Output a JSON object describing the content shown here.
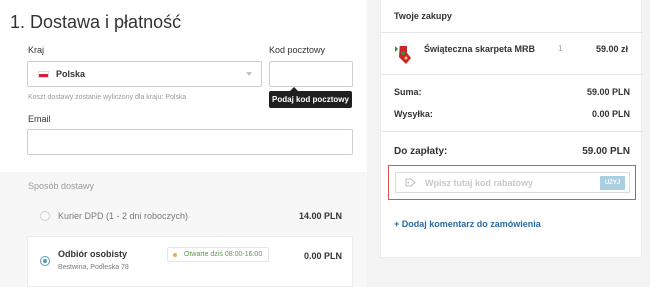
{
  "delivery": {
    "section_title": "1. Dostawa i płatność",
    "country_label": "Kraj",
    "country_value": "Polska",
    "postal_label": "Kod pocztowy",
    "postal_value": "",
    "postal_tooltip": "Podaj kod pocztowy",
    "shipping_hint": "Koszt dostawy zostanie wyliczony dla kraju: Polska",
    "email_label": "Email",
    "email_value": ""
  },
  "shipping": {
    "label": "Sposób dostawy",
    "options": [
      {
        "name": "Kurier DPD (1 - 2 dni roboczych)",
        "price": "14.00 PLN",
        "selected": false
      },
      {
        "name": "Odbiór osobisty",
        "address": "Bestwina, Podleska 78",
        "badge": "Otwarte dziś 08:00-16:00",
        "price": "0.00 PLN",
        "selected": true
      }
    ]
  },
  "cart": {
    "title": "Twoje zakupy",
    "item": {
      "name": "Świąteczna skarpeta MRB",
      "qty": "1",
      "price": "59.00 zł"
    },
    "sum_label": "Suma:",
    "sum_value": "59.00 PLN",
    "shipping_label": "Wysyłka:",
    "shipping_value": "0.00 PLN",
    "total_label": "Do zapłaty:",
    "total_value": "59.00 PLN",
    "coupon_placeholder": "Wpisz tutaj kod rabatowy",
    "coupon_button": "UŻYJ",
    "comment_link": "+ Dodaj komentarz do zamówienia"
  },
  "colors": {
    "accent_link": "#2a6aa0",
    "radio_selected": "#5a9ab5",
    "coupon_highlight": "#d9534f",
    "coupon_button": "#a9cfe0"
  }
}
